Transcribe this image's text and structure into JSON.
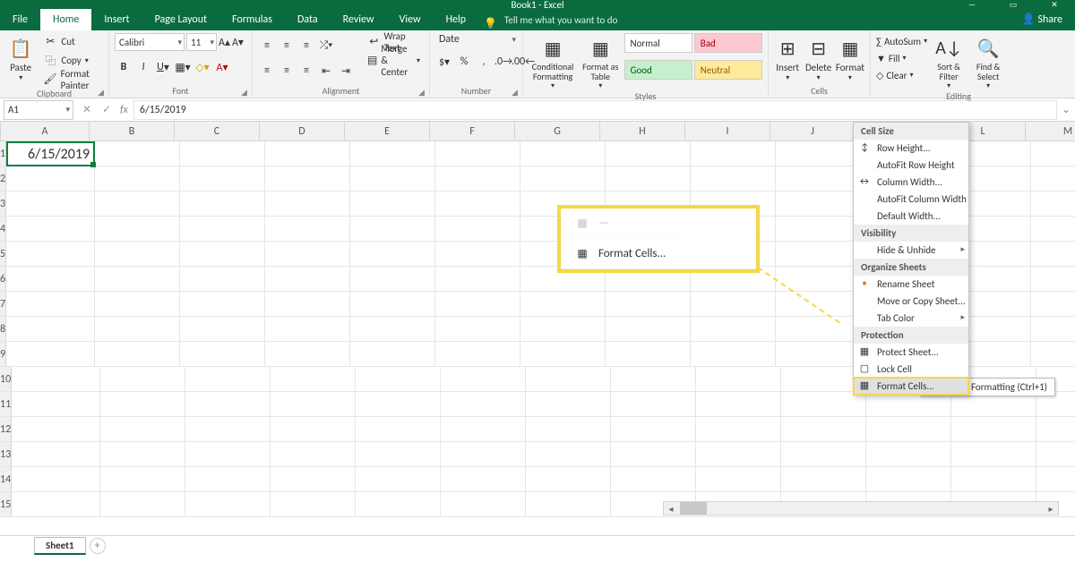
{
  "title_center": "Book1 - Excel",
  "share": "Share",
  "tabs": {
    "file": "File",
    "home": "Home",
    "insert": "Insert",
    "page": "Page Layout",
    "formulas": "Formulas",
    "data": "Data",
    "review": "Review",
    "view": "View",
    "help": "Help",
    "tell": "Tell me what you want to do"
  },
  "clipboard": {
    "cut": "Cut",
    "copy": "Copy",
    "fp": "Format Painter",
    "paste": "Paste",
    "label": "Clipboard"
  },
  "font": {
    "name": "Calibri",
    "size": "11",
    "label": "Font"
  },
  "alignment": {
    "wrap": "Wrap Text",
    "merge": "Merge & Center",
    "label": "Alignment"
  },
  "number": {
    "format": "Date",
    "label": "Number"
  },
  "styles": {
    "cf": "Conditional Formatting",
    "fat": "Format as Table",
    "normal": "Normal",
    "bad": "Bad",
    "good": "Good",
    "neutral": "Neutral",
    "label": "Styles"
  },
  "cells": {
    "insert": "Insert",
    "delete": "Delete",
    "format": "Format",
    "label": "Cells"
  },
  "editing": {
    "sum": "AutoSum",
    "fill": "Fill",
    "clear": "Clear",
    "sort": "Sort & Filter",
    "find": "Find & Select",
    "label": "Editing"
  },
  "namebox": "A1",
  "formula": "6/15/2019",
  "columns": [
    "A",
    "B",
    "C",
    "D",
    "E",
    "F",
    "G",
    "H",
    "I",
    "J",
    "K",
    "L",
    "M"
  ],
  "rows": [
    "1",
    "2",
    "3",
    "4",
    "5",
    "6",
    "7",
    "8",
    "9",
    "10",
    "11",
    "12",
    "13",
    "14",
    "15"
  ],
  "cell_value": "6/15/2019",
  "callout": {
    "item": "Format Cells..."
  },
  "dropdown": {
    "s1": "Cell Size",
    "rowh": "Row Height...",
    "afr": "AutoFit Row Height",
    "colw": "Column Width...",
    "afc": "AutoFit Column Width",
    "defw": "Default Width...",
    "s2": "Visibility",
    "hide": "Hide & Unhide",
    "s3": "Organize Sheets",
    "ren": "Rename Sheet",
    "move": "Move or Copy Sheet...",
    "tabc": "Tab Color",
    "s4": "Protection",
    "prot": "Protect Sheet...",
    "lock": "Lock Cell",
    "fmtc": "Format Cells..."
  },
  "tooltip": "Datasheet Formatting (Ctrl+1)",
  "sheettab": "Sheet1"
}
